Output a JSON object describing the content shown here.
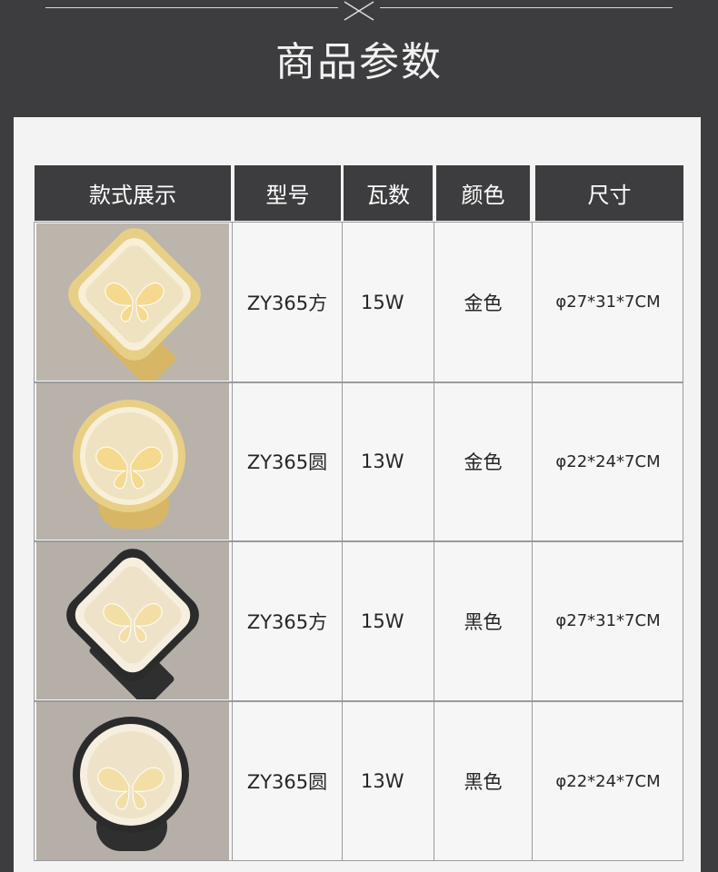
{
  "header": {
    "title": "商品参数"
  },
  "table": {
    "headers": [
      "款式展示",
      "型号",
      "瓦数",
      "颜色",
      "尺寸"
    ],
    "rows": [
      {
        "model": "ZY365方",
        "wattage": "15W",
        "color": "金色",
        "size": "φ27*31*7CM",
        "image": "gold-square-butterfly-lamp-image"
      },
      {
        "model": "ZY365圆",
        "wattage": "13W",
        "color": "金色",
        "size": "φ22*24*7CM",
        "image": "gold-round-butterfly-lamp-image"
      },
      {
        "model": "ZY365方",
        "wattage": "15W",
        "color": "黑色",
        "size": "φ27*31*7CM",
        "image": "black-square-butterfly-lamp-image"
      },
      {
        "model": "ZY365圆",
        "wattage": "13W",
        "color": "黑色",
        "size": "φ22*24*7CM",
        "image": "black-round-butterfly-lamp-image"
      }
    ]
  },
  "colors": {
    "background": "#3d3d3f",
    "panel": "#f3f3f3",
    "header_cell": "#3d3d3f",
    "gold": "#d9b865",
    "black": "#2b2b2b"
  }
}
